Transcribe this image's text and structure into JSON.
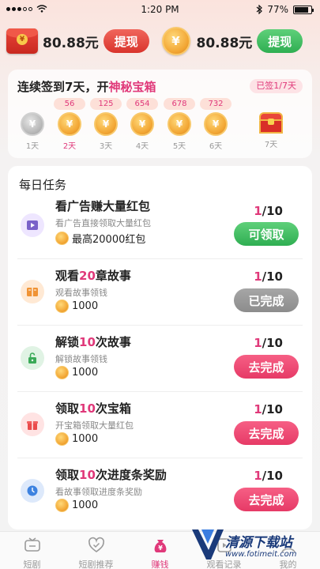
{
  "status_bar": {
    "time": "1:20 PM",
    "battery": "77%",
    "battery_level": 0.77
  },
  "balance": {
    "cash_amount": "80.88元",
    "cash_withdraw_label": "提现",
    "coin_amount": "80.88元",
    "coin_withdraw_label": "提现",
    "seal_glyph": "¥",
    "coin_glyph": "¥"
  },
  "checkin": {
    "title_prefix": "连续签到7天，开",
    "title_highlight": "神秘宝箱",
    "signed_badge": "已签1/7天",
    "days": [
      {
        "bonus": "",
        "label": "1天",
        "state": "grey"
      },
      {
        "bonus": "56",
        "label": "2天",
        "state": "active"
      },
      {
        "bonus": "125",
        "label": "3天",
        "state": "gold"
      },
      {
        "bonus": "654",
        "label": "4天",
        "state": "gold"
      },
      {
        "bonus": "678",
        "label": "5天",
        "state": "gold"
      },
      {
        "bonus": "732",
        "label": "6天",
        "state": "gold"
      },
      {
        "bonus": "",
        "label": "7天",
        "state": "chest"
      }
    ],
    "coin_glyph": "¥"
  },
  "tasks": {
    "title": "每日任务",
    "items": [
      {
        "name_parts": [
          "看广告赚大量红包",
          "",
          ""
        ],
        "desc": "看广告直接领取大量红包",
        "reward": "最高20000红包",
        "current": "1",
        "total": "/10",
        "button": "可领取",
        "button_style": "green",
        "icon": "video-icon"
      },
      {
        "name_parts": [
          "观看",
          "20",
          "章故事"
        ],
        "desc": "观看故事领钱",
        "reward": "1000",
        "current": "1",
        "total": "/10",
        "button": "已完成",
        "button_style": "grey",
        "icon": "book-icon"
      },
      {
        "name_parts": [
          "解锁",
          "10",
          "次故事"
        ],
        "desc": "解锁故事领钱",
        "reward": "1000",
        "current": "1",
        "total": "/10",
        "button": "去完成",
        "button_style": "pink",
        "icon": "unlock-icon"
      },
      {
        "name_parts": [
          "领取",
          "10",
          "次宝箱"
        ],
        "desc": "开宝箱领取大量红包",
        "reward": "1000",
        "current": "1",
        "total": "/10",
        "button": "去完成",
        "button_style": "pink",
        "icon": "gift-icon"
      },
      {
        "name_parts": [
          "领取",
          "10",
          "次进度条奖励"
        ],
        "desc": "看故事领取进度条奖励",
        "reward": "1000",
        "current": "1",
        "total": "/10",
        "button": "去完成",
        "button_style": "pink",
        "icon": "clock-icon"
      }
    ]
  },
  "bottom_nav": {
    "items": [
      {
        "label": "短剧",
        "icon": "tv-icon"
      },
      {
        "label": "短剧推荐",
        "icon": "heart-check-icon"
      },
      {
        "label": "赚钱",
        "icon": "money-bag-icon",
        "active": true
      },
      {
        "label": "观看记录",
        "icon": "history-icon"
      },
      {
        "label": "我的",
        "icon": "profile-icon"
      }
    ]
  },
  "watermark": {
    "text": "清源下载站",
    "url": "www.fotimeit.com"
  },
  "colors": {
    "accent": "#e0397a",
    "green": "#2fae52",
    "gold": "#f2a634"
  }
}
